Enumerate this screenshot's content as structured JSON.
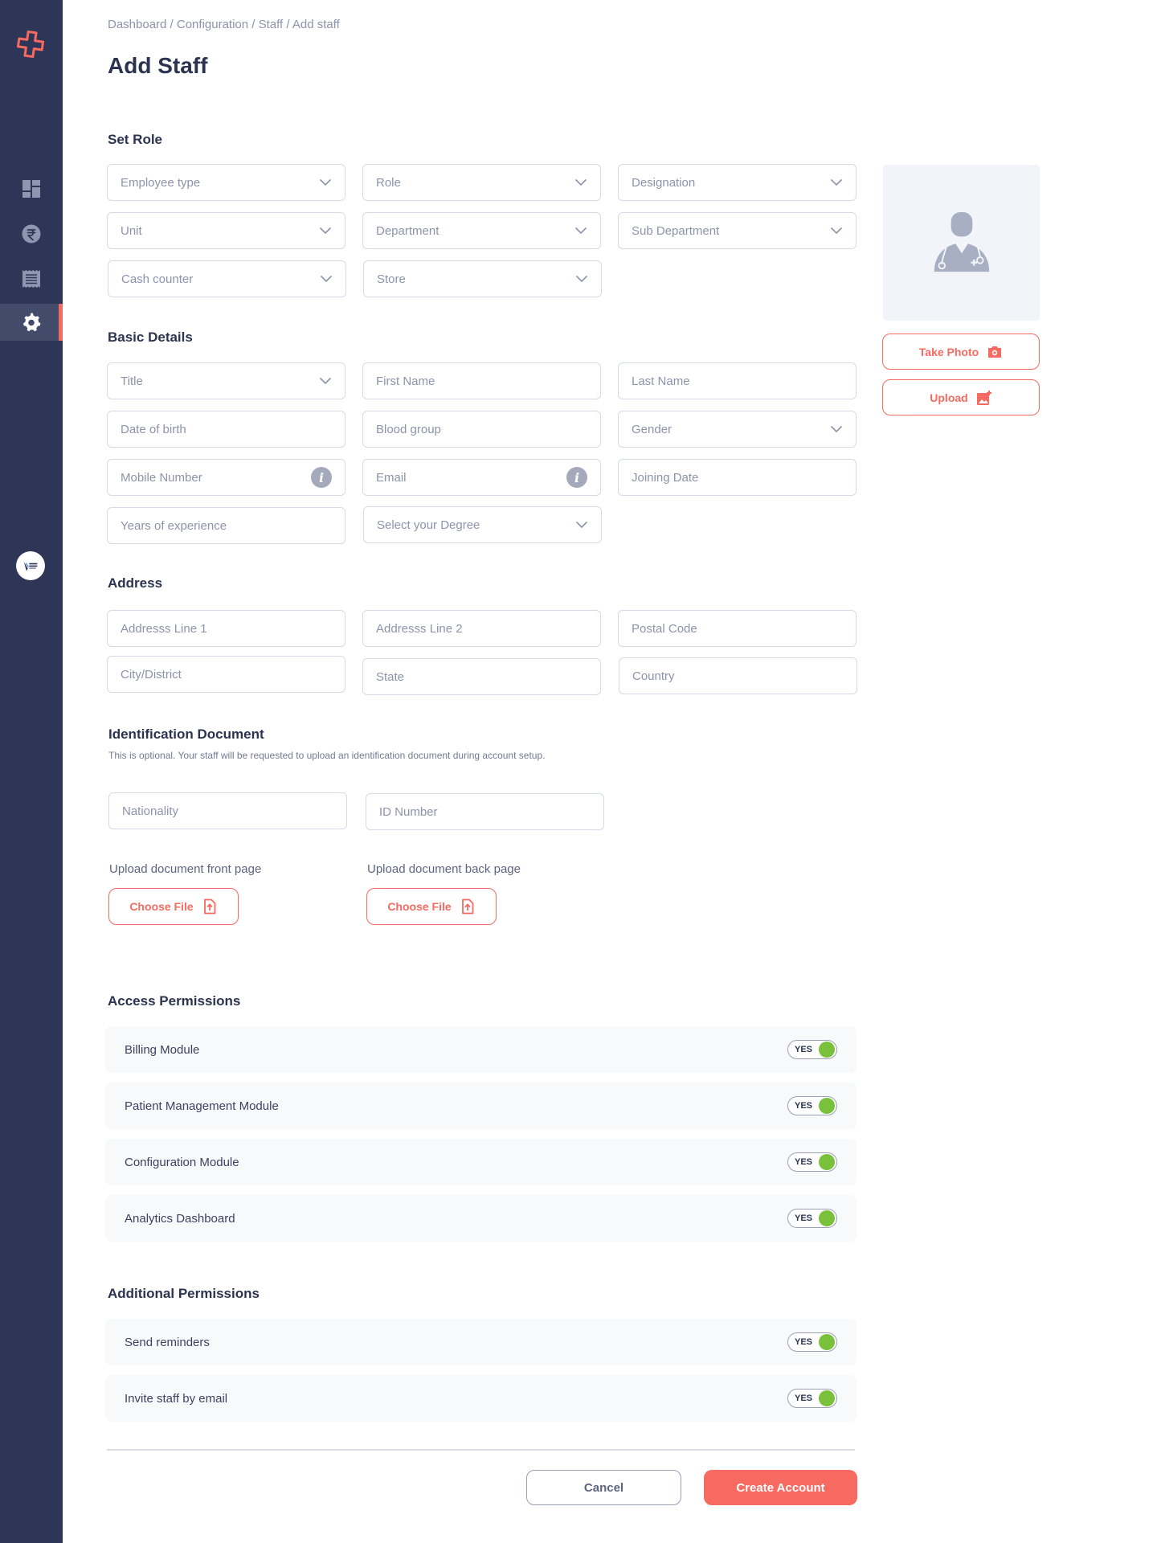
{
  "breadcrumb": "Dashboard / Configuration / Staff / Add staff",
  "page_title": "Add Staff",
  "sections": {
    "set_role": "Set Role",
    "basic_details": "Basic Details",
    "address": "Address",
    "identification": "Identification Document",
    "identification_note": "This is optional. Your staff will be requested to upload an identification document during account setup.",
    "access_permissions": "Access Permissions",
    "additional_permissions": "Additional Permissions"
  },
  "set_role": {
    "employee_type": "Employee type",
    "role": "Role",
    "designation": "Designation",
    "unit": "Unit",
    "department": "Department",
    "sub_department": "Sub Department",
    "cash_counter": "Cash counter",
    "store": "Store"
  },
  "basic_details": {
    "title": "Title",
    "first_name": "First Name",
    "last_name": "Last Name",
    "dob": "Date of birth",
    "blood_group": "Blood group",
    "gender": "Gender",
    "mobile": "Mobile Number",
    "email": "Email",
    "joining_date": "Joining Date",
    "experience": "Years of experience",
    "degree": "Select your Degree"
  },
  "address": {
    "line1": "Addresss Line 1",
    "line2": "Addresss Line 2",
    "postal": "Postal Code",
    "city": "City/District",
    "state": "State",
    "country": "Country"
  },
  "identification": {
    "nationality": "Nationality",
    "id_number": "ID Number",
    "front_label": "Upload document front page",
    "back_label": "Upload document back page",
    "choose_file": "Choose File"
  },
  "photo": {
    "take_photo": "Take Photo",
    "upload": "Upload"
  },
  "access_permissions": [
    {
      "label": "Billing Module",
      "toggle": "YES"
    },
    {
      "label": "Patient Management Module",
      "toggle": "YES"
    },
    {
      "label": "Configuration Module",
      "toggle": "YES"
    },
    {
      "label": "Analytics Dashboard",
      "toggle": "YES"
    }
  ],
  "additional_permissions": [
    {
      "label": "Send reminders",
      "toggle": "YES"
    },
    {
      "label": "Invite staff by email",
      "toggle": "YES"
    }
  ],
  "actions": {
    "cancel": "Cancel",
    "create": "Create Account"
  },
  "colors": {
    "sidebar": "#2e3657",
    "accent": "#f76a61",
    "toggle_on": "#79c13a"
  },
  "icons": {
    "sidebar": [
      "dashboard-icon",
      "rupee-icon",
      "receipt-icon",
      "settings-icon"
    ]
  }
}
